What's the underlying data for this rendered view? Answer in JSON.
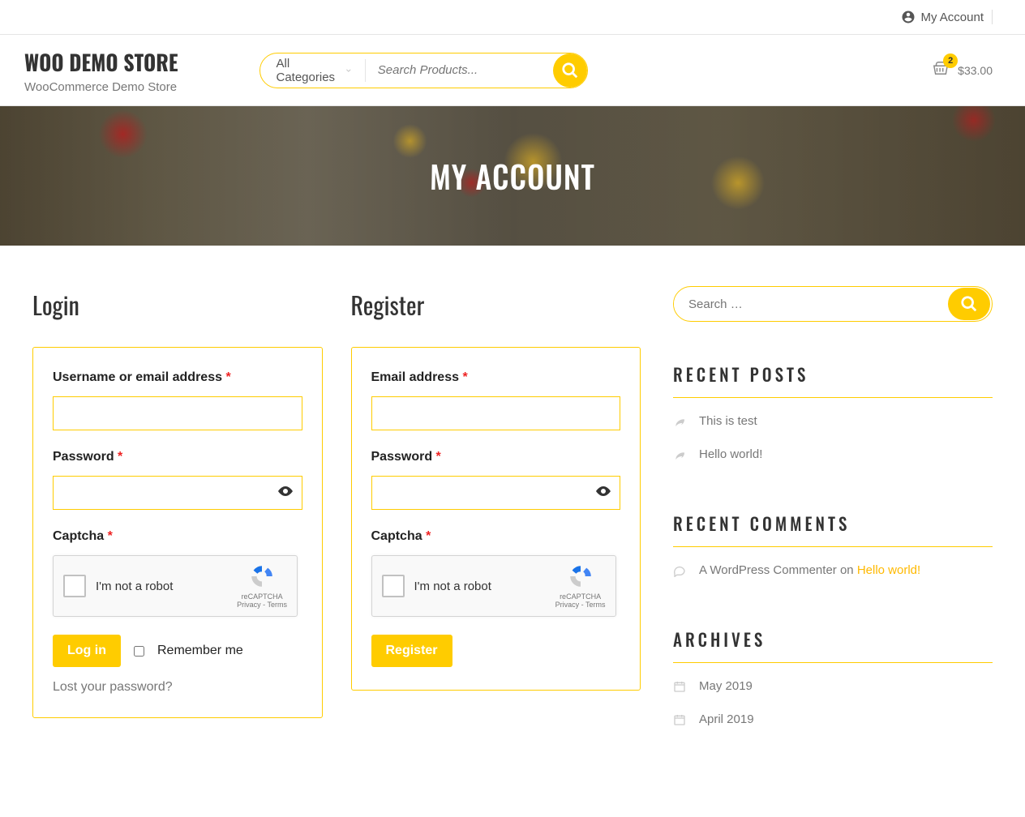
{
  "topbar": {
    "account_link": "My Account"
  },
  "brand": {
    "title": "WOO DEMO STORE",
    "tagline": "WooCommerce Demo Store"
  },
  "search": {
    "category_label": "All Categories",
    "placeholder": "Search Products..."
  },
  "cart": {
    "count": "2",
    "total": "$33.00"
  },
  "hero": {
    "title": "MY ACCOUNT"
  },
  "login": {
    "heading": "Login",
    "username_label": "Username or email address",
    "password_label": "Password",
    "captcha_label": "Captcha",
    "recaptcha_text": "I'm not a robot",
    "recaptcha_brand": "reCAPTCHA",
    "recaptcha_terms": "Privacy - Terms",
    "submit": "Log in",
    "remember": "Remember me",
    "lost_password": "Lost your password?"
  },
  "register": {
    "heading": "Register",
    "email_label": "Email address",
    "password_label": "Password",
    "captcha_label": "Captcha",
    "recaptcha_text": "I'm not a robot",
    "recaptcha_brand": "reCAPTCHA",
    "recaptcha_terms": "Privacy - Terms",
    "submit": "Register"
  },
  "sidebar": {
    "search_placeholder": "Search …",
    "recent_posts": {
      "title": "RECENT POSTS",
      "items": [
        "This is test",
        "Hello world!"
      ]
    },
    "recent_comments": {
      "title": "RECENT COMMENTS",
      "items": [
        {
          "author": "A WordPress Commenter",
          "on": " on ",
          "post": "Hello world!"
        }
      ]
    },
    "archives": {
      "title": "ARCHIVES",
      "items": [
        "May 2019",
        "April 2019"
      ]
    }
  }
}
